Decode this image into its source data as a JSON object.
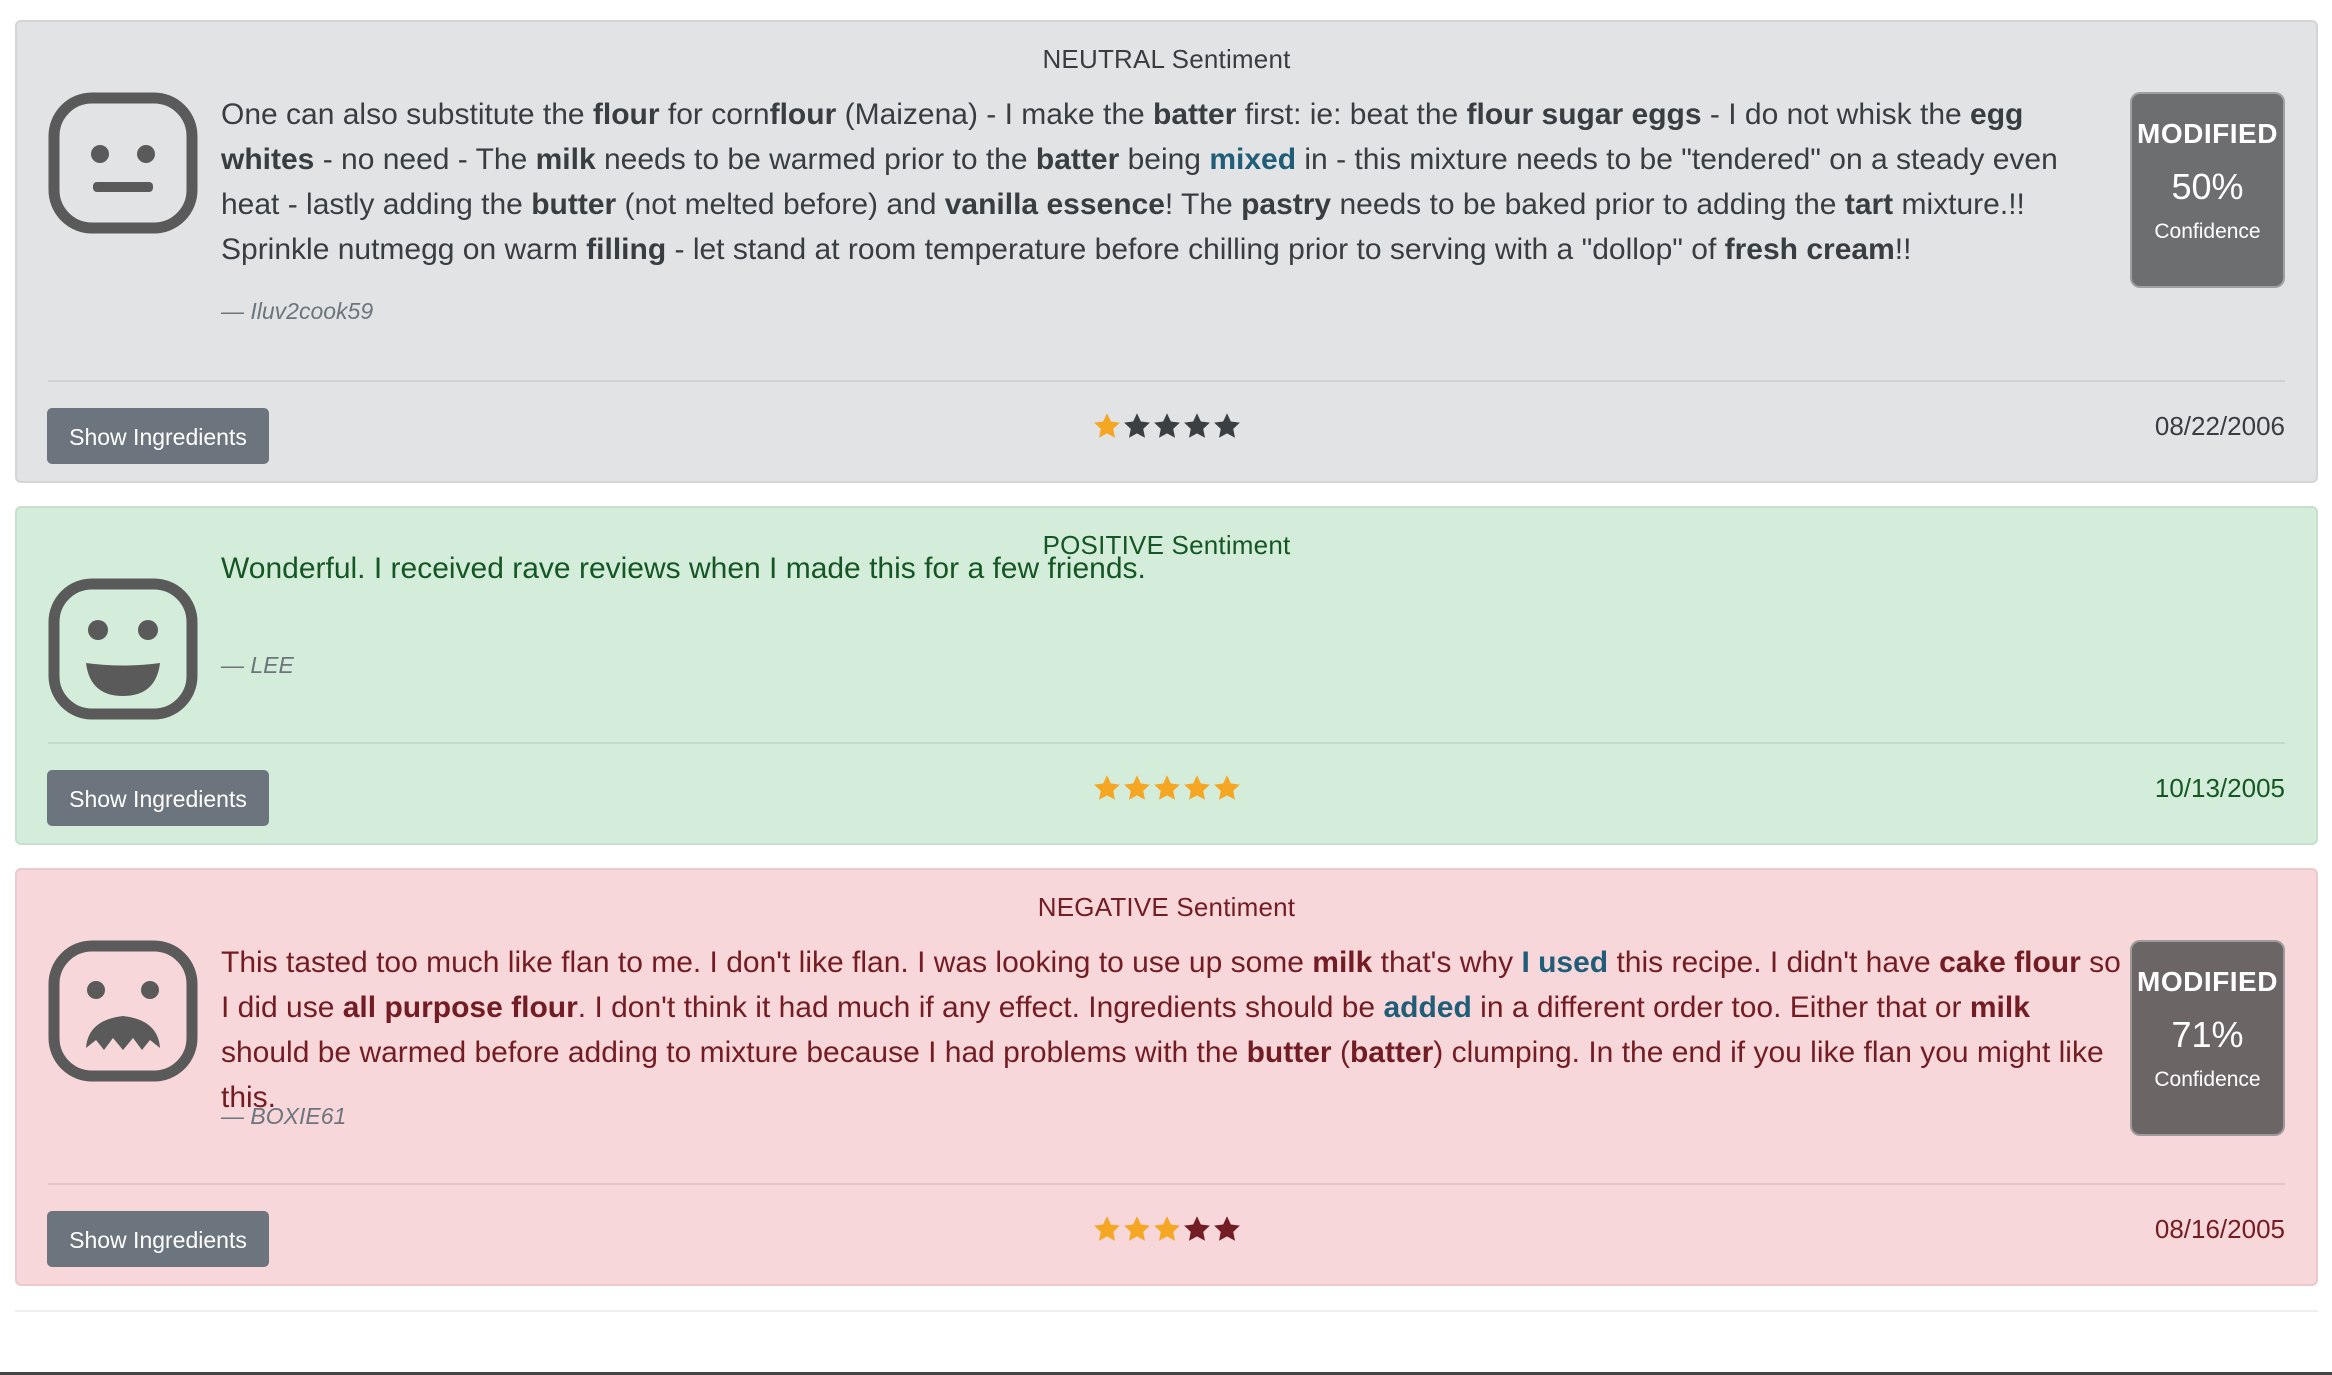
{
  "colors": {
    "star_filled": "#f5a623",
    "neutral_bg": "#e2e3e5",
    "positive_bg": "#d4edda",
    "negative_bg": "#f8d7da",
    "button_bg": "#6c757d",
    "badge_bg": "#6c6e70"
  },
  "reviews": [
    {
      "sentiment_label": "NEUTRAL Sentiment",
      "face_icon": "neutral-face-icon",
      "segments": [
        {
          "t": "One can also substitute the ",
          "s": "n"
        },
        {
          "t": "flour",
          "s": "b"
        },
        {
          "t": " for corn",
          "s": "n"
        },
        {
          "t": "flour",
          "s": "b"
        },
        {
          "t": " (Maizena) - I make the ",
          "s": "n"
        },
        {
          "t": "batter",
          "s": "b"
        },
        {
          "t": " first: ie: beat the ",
          "s": "n"
        },
        {
          "t": "flour sugar eggs",
          "s": "b"
        },
        {
          "t": " - I do not whisk the ",
          "s": "n"
        },
        {
          "t": "egg whites",
          "s": "b"
        },
        {
          "t": " - no need - The ",
          "s": "n"
        },
        {
          "t": "milk",
          "s": "b"
        },
        {
          "t": " needs to be warmed prior to the ",
          "s": "n"
        },
        {
          "t": "batter",
          "s": "b"
        },
        {
          "t": " being ",
          "s": "n"
        },
        {
          "t": "mixed",
          "s": "h"
        },
        {
          "t": " in - this mixture needs to be \"tendered\" on a steady even heat - lastly adding the ",
          "s": "n"
        },
        {
          "t": "butter",
          "s": "b"
        },
        {
          "t": " (not melted before) and ",
          "s": "n"
        },
        {
          "t": "vanilla essence",
          "s": "b"
        },
        {
          "t": "! The ",
          "s": "n"
        },
        {
          "t": "pastry",
          "s": "b"
        },
        {
          "t": " needs to be baked prior to adding the ",
          "s": "n"
        },
        {
          "t": "tart",
          "s": "b"
        },
        {
          "t": " mixture.!! Sprinkle nutmegg on warm ",
          "s": "n"
        },
        {
          "t": "filling",
          "s": "b"
        },
        {
          "t": " - let stand at room temperature before chilling prior to serving with a \"dollop\" of ",
          "s": "n"
        },
        {
          "t": "fresh cream",
          "s": "b"
        },
        {
          "t": "!!",
          "s": "n"
        }
      ],
      "author": "— Iluv2cook59",
      "button_label": "Show Ingredients",
      "rating": 1,
      "star_empty_color": "#3a3f44",
      "date": "08/22/2006",
      "badge": {
        "title": "MODIFIED",
        "value": "50%",
        "label": "Confidence"
      }
    },
    {
      "sentiment_label": "POSITIVE Sentiment",
      "face_icon": "happy-face-icon",
      "segments": [
        {
          "t": "Wonderful. I received rave reviews when I made this for a few friends.",
          "s": "n"
        }
      ],
      "author": "— LEE",
      "button_label": "Show Ingredients",
      "rating": 5,
      "star_empty_color": "#3a3f44",
      "date": "10/13/2005",
      "badge": null
    },
    {
      "sentiment_label": "NEGATIVE Sentiment",
      "face_icon": "angry-face-icon",
      "segments": [
        {
          "t": "This tasted too much like flan to me. I don't like flan. I was looking to use up some ",
          "s": "n"
        },
        {
          "t": "milk",
          "s": "b"
        },
        {
          "t": " that's why ",
          "s": "n"
        },
        {
          "t": "I used",
          "s": "h"
        },
        {
          "t": " this recipe. I didn't have ",
          "s": "n"
        },
        {
          "t": "cake flour",
          "s": "b"
        },
        {
          "t": " so I did use ",
          "s": "n"
        },
        {
          "t": "all purpose flour",
          "s": "b"
        },
        {
          "t": ". I don't think it had much if any effect. Ingredients should be ",
          "s": "n"
        },
        {
          "t": "added",
          "s": "h"
        },
        {
          "t": " in a different order too. Either that or ",
          "s": "n"
        },
        {
          "t": "milk",
          "s": "b"
        },
        {
          "t": " should be warmed before adding to mixture because I had problems with the ",
          "s": "n"
        },
        {
          "t": "butter",
          "s": "b"
        },
        {
          "t": " (",
          "s": "n"
        },
        {
          "t": "batter",
          "s": "b"
        },
        {
          "t": ") clumping. In the end if you like flan you might like this.",
          "s": "n"
        }
      ],
      "author": "— BOXIE61",
      "button_label": "Show Ingredients",
      "rating": 3,
      "star_empty_color": "#721c24",
      "date": "08/16/2005",
      "badge": {
        "title": "MODIFIED",
        "value": "71%",
        "label": "Confidence"
      }
    }
  ]
}
